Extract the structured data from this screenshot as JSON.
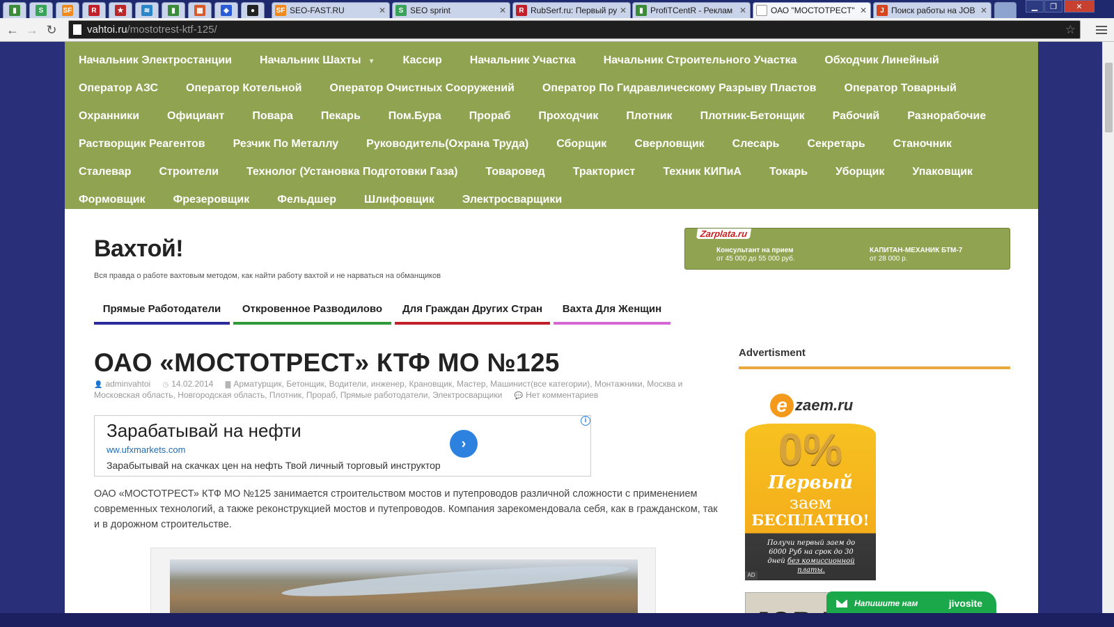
{
  "browser": {
    "pinned_tabs": [
      {
        "icon": "chart-icon",
        "glyph": "▮",
        "color": "#3b8b3b"
      },
      {
        "icon": "seo-sprint-icon",
        "glyph": "S",
        "color": "#3aa35a"
      },
      {
        "icon": "seo-fast-icon",
        "glyph": "SF",
        "color": "#f08a1f"
      },
      {
        "icon": "rubserf-icon",
        "glyph": "R",
        "color": "#c0202a"
      },
      {
        "icon": "emblem-icon",
        "glyph": "★",
        "color": "#b8282a"
      },
      {
        "icon": "wave-icon",
        "glyph": "≋",
        "color": "#2a86c8"
      },
      {
        "icon": "chart-icon",
        "glyph": "▮",
        "color": "#3b8b3b"
      },
      {
        "icon": "grid-icon",
        "glyph": "▦",
        "color": "#d65a2a"
      },
      {
        "icon": "shield-icon",
        "glyph": "◈",
        "color": "#2a5ad6"
      },
      {
        "icon": "hat-icon",
        "glyph": "●",
        "color": "#222222"
      }
    ],
    "tabs": [
      {
        "title": "SEO-FAST.RU",
        "icon": "seo-fast-icon",
        "glyph": "SF",
        "color": "#f08a1f",
        "active": false
      },
      {
        "title": "SEO sprint",
        "icon": "seo-sprint-icon",
        "glyph": "S",
        "color": "#3aa35a",
        "active": false
      },
      {
        "title": "RubSerf.ru: Первый ру",
        "icon": "rubserf-icon",
        "glyph": "R",
        "color": "#c0202a",
        "active": false
      },
      {
        "title": "ProfiTCentR - Реклам",
        "icon": "chart-icon",
        "glyph": "▮",
        "color": "#3b8b3b",
        "active": false
      },
      {
        "title": "ОАО \"МОСТОТРЕСТ\"",
        "icon": "page-icon",
        "glyph": "",
        "color": "#ffffff",
        "active": true
      },
      {
        "title": "Поиск работы на JOB",
        "icon": "job-icon",
        "glyph": "J",
        "color": "#d6451f",
        "active": false
      }
    ],
    "url_host": "vahtoi.ru",
    "url_path": "/mostotrest-ktf-125/"
  },
  "topnav": {
    "rows": [
      [
        "Начальник Электростанции",
        "Начальник Шахты",
        "Кассир",
        "Начальник Участка",
        "Начальник Строительного Участка",
        "Обходчик Линейный"
      ],
      [
        "Оператор АЗС",
        "Оператор Котельной",
        "Оператор Очистных Сооружений",
        "Оператор По Гидравлическому Разрыву Пластов",
        "Оператор Товарный"
      ],
      [
        "Охранники",
        "Официант",
        "Повара",
        "Пекарь",
        "Пом.Бура",
        "Прораб",
        "Проходчик",
        "Плотник",
        "Плотник-Бетонщик",
        "Рабочий",
        "Разнорабочие"
      ],
      [
        "Растворщик Реагентов",
        "Резчик По Металлу",
        "Руководитель(Охрана Труда)",
        "Сборщик",
        "Сверловщик",
        "Слесарь",
        "Секретарь",
        "Станочник"
      ],
      [
        "Сталевар",
        "Строители",
        "Технолог (Установка Подготовки Газа)",
        "Товаровед",
        "Тракторист",
        "Техник КИПиА",
        "Токарь",
        "Уборщик",
        "Упаковщик"
      ],
      [
        "Формовщик",
        "Фрезеровщик",
        "Фельдшер",
        "Шлифовщик",
        "Электросварщики"
      ]
    ],
    "dropdown_item": "Начальник Шахты"
  },
  "site": {
    "title": "Вахтой!",
    "description": "Вся правда о работе вахтовым методом, как найти работу вахтой и не нарваться на обманщиков"
  },
  "zarplata": {
    "logo": "Zarplata.ru",
    "jobs": [
      {
        "title": "Консультант на прием",
        "salary": "от 45 000 до 55 000 руб."
      },
      {
        "title": "КАПИТАН-МЕХАНИК БТМ-7",
        "salary": "от 28 000 р."
      }
    ]
  },
  "secnav": [
    {
      "label": "Прямые Работодатели",
      "color": "#2b2a9c"
    },
    {
      "label": "Откровенное Разводилово",
      "color": "#2e9a3a"
    },
    {
      "label": "Для Граждан Других Стран",
      "color": "#c0202a"
    },
    {
      "label": "Вахта Для Женщин",
      "color": "#d668d6"
    }
  ],
  "post": {
    "title": "ОАО «МОСТОТРЕСТ» КТФ МО №125",
    "author": "adminvahtoi",
    "date": "14.02.2014",
    "categories": "Арматурщик, Бетонщик, Водители, инженер, Крановщик, Мастер, Машинист(все категории), Монтажники, Москва и Московская область, Новгородская область, Плотник, Прораб, Прямые работодатели, Электросварщики",
    "comments": "Нет комментариев",
    "body": "ОАО «МОСТОТРЕСТ» КТФ МО №125 занимается строительством мостов и путепроводов различной сложности с применением современных технологий, а также реконструкцией мостов и путепроводов. Компания зарекомендовала себя, как в гражданском, так и в дорожном строительстве."
  },
  "ad": {
    "headline": "Зарабатывай на нефти",
    "url": "ww.ufxmarkets.com",
    "text": "Зарабытывай на скачках цен на нефть Твой личный торговый инструктор",
    "info": "i"
  },
  "sidebar": {
    "title": "Advertisment",
    "ezaem": {
      "brand_letter": "e",
      "brand_name": "zaem.ru",
      "percent": "0%",
      "line1": "Первый",
      "line2": "заем",
      "line3": "БЕСПЛАТНО!",
      "fine_1": "Получи первый заем до 6000 Руб на срок до 30 дней",
      "fine_2": "без комиссионной платы.",
      "adchoice": "AD"
    },
    "jobru": "JOB.RU"
  },
  "jivo": {
    "label": "Напишите нам",
    "brand": "jivosite"
  }
}
